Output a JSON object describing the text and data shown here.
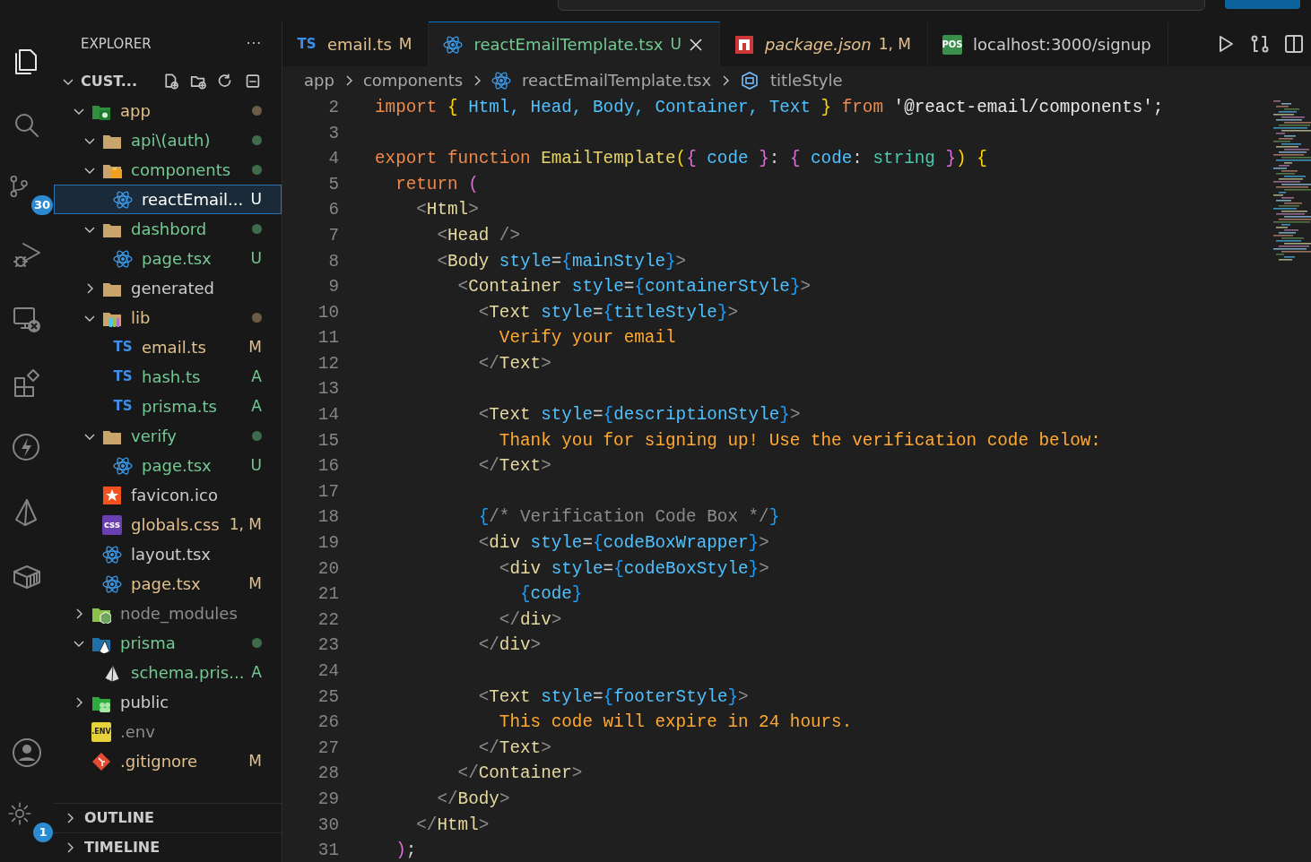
{
  "activity_bar": [
    {
      "kind": "files",
      "selected": true
    },
    {
      "kind": "search",
      "selected": false
    },
    {
      "kind": "branch",
      "selected": false,
      "badge": "30"
    },
    {
      "kind": "debug",
      "selected": false
    },
    {
      "kind": "remote",
      "selected": false
    },
    {
      "kind": "extensions",
      "selected": false
    },
    {
      "kind": "bolt",
      "selected": false
    },
    {
      "kind": "prism",
      "selected": false
    },
    {
      "kind": "box",
      "selected": false
    }
  ],
  "activity_bottom": [
    {
      "kind": "account",
      "selected": false
    },
    {
      "kind": "gear",
      "selected": false,
      "badge": "1"
    }
  ],
  "sidebar": {
    "title": "EXPLORER",
    "more": "···",
    "root": {
      "label": "CUST...",
      "expanded": true
    },
    "tree": [
      {
        "label": "app",
        "kind": "folder-app",
        "color": "#e2c08d",
        "expanded": true,
        "dot": {
          "color": "#6e5b45"
        },
        "selected": false,
        "children": [
          {
            "label": "api\\(auth)",
            "kind": "folder",
            "color": "#73c991",
            "expanded": true,
            "dot": {
              "color": "#3d6b4b"
            },
            "selected": false
          },
          {
            "label": "components",
            "kind": "folder-components",
            "color": "#73c991",
            "expanded": true,
            "dot": {
              "color": "#3d6b4b"
            },
            "selected": false,
            "children": [
              {
                "label": "reactEmail...",
                "kind": "atom",
                "status": "U",
                "selected": true
              }
            ]
          },
          {
            "label": "dashbord",
            "kind": "folder",
            "color": "#73c991",
            "expanded": true,
            "dot": {
              "color": "#3d6b4b"
            },
            "selected": false,
            "children": [
              {
                "label": "page.tsx",
                "kind": "atom",
                "color": "#73c991",
                "status": "U",
                "selected": false
              }
            ]
          },
          {
            "label": "generated",
            "kind": "folder",
            "color": "#cccccc",
            "expanded": false,
            "selected": false
          },
          {
            "label": "lib",
            "kind": "folder-lib",
            "color": "#e2c08d",
            "expanded": true,
            "dot": {
              "color": "#6e5b45"
            },
            "selected": false,
            "children": [
              {
                "label": "email.ts",
                "kind": "ts",
                "icon_label": "TS",
                "color": "#e2c08d",
                "status": "M",
                "selected": false
              },
              {
                "label": "hash.ts",
                "kind": "ts",
                "icon_label": "TS",
                "color": "#73c991",
                "status": "A",
                "selected": false
              },
              {
                "label": "prisma.ts",
                "kind": "ts",
                "icon_label": "TS",
                "color": "#73c991",
                "status": "A",
                "selected": false
              }
            ]
          },
          {
            "label": "verify",
            "kind": "folder",
            "color": "#73c991",
            "expanded": true,
            "dot": {
              "color": "#3d6b4b"
            },
            "selected": false,
            "children": [
              {
                "label": "page.tsx",
                "kind": "atom",
                "color": "#73c991",
                "status": "U",
                "selected": false
              }
            ]
          },
          {
            "label": "favicon.ico",
            "kind": "star",
            "color": "#cccccc",
            "selected": false
          },
          {
            "label": "globals.css",
            "kind": "css",
            "icon_label": "css",
            "color": "#e2c08d",
            "status": "1, M",
            "selected": false
          },
          {
            "label": "layout.tsx",
            "kind": "atom",
            "color": "#cccccc",
            "selected": false
          },
          {
            "label": "page.tsx",
            "kind": "atom",
            "color": "#e2c08d",
            "status": "M",
            "selected": false
          }
        ]
      },
      {
        "label": "node_modules",
        "kind": "folder-node",
        "color": "#8c8c8c",
        "expanded": false,
        "selected": false
      },
      {
        "label": "prisma",
        "kind": "folder-prisma",
        "color": "#73c991",
        "expanded": true,
        "dot": {
          "color": "#3d6b4b"
        },
        "selected": false,
        "children": [
          {
            "label": "schema.pris...",
            "kind": "prism",
            "color": "#73c991",
            "status": "A",
            "selected": false
          }
        ]
      },
      {
        "label": "public",
        "kind": "folder-public",
        "color": "#cccccc",
        "expanded": false,
        "selected": false
      },
      {
        "label": ".env",
        "kind": "env",
        "icon_label": ".ENV",
        "color": "#8c8c8c",
        "selected": false
      },
      {
        "label": ".gitignore",
        "kind": "git",
        "color": "#e2c08d",
        "status": "M",
        "selected": false
      }
    ],
    "sections": [
      {
        "label": "OUTLINE",
        "expanded": false
      },
      {
        "label": "TIMELINE",
        "expanded": false
      }
    ]
  },
  "tabs": [
    {
      "label": "email.ts",
      "kind": "ts",
      "icon_label": "TS",
      "status": "M",
      "color": "#e2c08d",
      "selected": false,
      "preview": false
    },
    {
      "label": "reactEmailTemplate.tsx",
      "kind": "atom",
      "status": "U",
      "color": "#73c991",
      "selected": true,
      "preview": false
    },
    {
      "label": "package.json",
      "kind": "npm",
      "status": "1, M",
      "color": "#e2c08d",
      "selected": false,
      "preview": true
    },
    {
      "label": "localhost:3000/signup",
      "kind": "pos",
      "icon_label": "POS",
      "color": "#cccccc",
      "selected": false,
      "preview": false
    }
  ],
  "breadcrumb": [
    {
      "label": "app"
    },
    {
      "label": "components"
    },
    {
      "label": "reactEmailTemplate.tsx",
      "kind": "atom"
    },
    {
      "label": "titleStyle",
      "kind": "symbol"
    }
  ],
  "code": [
    {
      "number": "2",
      "tokens": [
        {
          "kind": "kw",
          "text": "import "
        },
        {
          "kind": "b1",
          "text": "{"
        },
        {
          "kind": "id",
          "text": " Html, Head, Body, Container, Text "
        },
        {
          "kind": "b1",
          "text": "}"
        },
        {
          "kind": "kw",
          "text": " from "
        },
        {
          "kind": "str",
          "text": "'@react-email/components';"
        }
      ]
    },
    {
      "number": "3"
    },
    {
      "number": "4",
      "tokens": [
        {
          "kind": "kw",
          "text": "export function "
        },
        {
          "kind": "fn",
          "text": "EmailTemplate"
        },
        {
          "kind": "b1",
          "text": "("
        },
        {
          "kind": "b2",
          "text": "{"
        },
        {
          "kind": "id",
          "text": " code "
        },
        {
          "kind": "b2",
          "text": "}"
        },
        {
          "kind": "p",
          "text": ": "
        },
        {
          "kind": "b2",
          "text": "{"
        },
        {
          "kind": "id",
          "text": " code"
        },
        {
          "kind": "p",
          "text": ": "
        },
        {
          "kind": "type",
          "text": "string"
        },
        {
          "kind": "b2",
          "text": " }"
        },
        {
          "kind": "b1",
          "text": ") {"
        }
      ]
    },
    {
      "number": "5",
      "tokens": [
        {
          "kind": "kw",
          "text": "  return "
        },
        {
          "kind": "b2",
          "text": "("
        }
      ]
    },
    {
      "number": "6",
      "tokens": [
        {
          "kind": "tb",
          "text": "    <"
        },
        {
          "kind": "tag",
          "text": "Html"
        },
        {
          "kind": "tb",
          "text": ">"
        }
      ]
    },
    {
      "number": "7",
      "tokens": [
        {
          "kind": "tb",
          "text": "      <"
        },
        {
          "kind": "tag",
          "text": "Head"
        },
        {
          "kind": "tb",
          "text": " />"
        }
      ]
    },
    {
      "number": "8",
      "tokens": [
        {
          "kind": "tb",
          "text": "      <"
        },
        {
          "kind": "tag",
          "text": "Body"
        },
        {
          "kind": "attr",
          "text": " style"
        },
        {
          "kind": "p",
          "text": "="
        },
        {
          "kind": "b3",
          "text": "{"
        },
        {
          "kind": "id",
          "text": "mainStyle"
        },
        {
          "kind": "b3",
          "text": "}"
        },
        {
          "kind": "tb",
          "text": ">"
        }
      ]
    },
    {
      "number": "9",
      "tokens": [
        {
          "kind": "tb",
          "text": "        <"
        },
        {
          "kind": "tag",
          "text": "Container"
        },
        {
          "kind": "attr",
          "text": " style"
        },
        {
          "kind": "p",
          "text": "="
        },
        {
          "kind": "b3",
          "text": "{"
        },
        {
          "kind": "id",
          "text": "containerStyle"
        },
        {
          "kind": "b3",
          "text": "}"
        },
        {
          "kind": "tb",
          "text": ">"
        }
      ]
    },
    {
      "number": "10",
      "tokens": [
        {
          "kind": "tb",
          "text": "          <"
        },
        {
          "kind": "tag",
          "text": "Text"
        },
        {
          "kind": "attr",
          "text": " style"
        },
        {
          "kind": "p",
          "text": "="
        },
        {
          "kind": "b3",
          "text": "{"
        },
        {
          "kind": "id",
          "text": "titleStyle"
        },
        {
          "kind": "b3",
          "text": "}"
        },
        {
          "kind": "tb",
          "text": ">"
        }
      ]
    },
    {
      "number": "11",
      "tokens": [
        {
          "kind": "txt",
          "text": "            Verify your email"
        }
      ]
    },
    {
      "number": "12",
      "tokens": [
        {
          "kind": "tb",
          "text": "          </"
        },
        {
          "kind": "tag",
          "text": "Text"
        },
        {
          "kind": "tb",
          "text": ">"
        }
      ]
    },
    {
      "number": "13"
    },
    {
      "number": "14",
      "tokens": [
        {
          "kind": "tb",
          "text": "          <"
        },
        {
          "kind": "tag",
          "text": "Text"
        },
        {
          "kind": "attr",
          "text": " style"
        },
        {
          "kind": "p",
          "text": "="
        },
        {
          "kind": "b3",
          "text": "{"
        },
        {
          "kind": "id",
          "text": "descriptionStyle"
        },
        {
          "kind": "b3",
          "text": "}"
        },
        {
          "kind": "tb",
          "text": ">"
        }
      ]
    },
    {
      "number": "15",
      "tokens": [
        {
          "kind": "txt",
          "text": "            Thank you for signing up! Use the verification code below:"
        }
      ]
    },
    {
      "number": "16",
      "tokens": [
        {
          "kind": "tb",
          "text": "          </"
        },
        {
          "kind": "tag",
          "text": "Text"
        },
        {
          "kind": "tb",
          "text": ">"
        }
      ]
    },
    {
      "number": "17"
    },
    {
      "number": "18",
      "tokens": [
        {
          "kind": "b3",
          "text": "          {"
        },
        {
          "kind": "cm",
          "text": "/* Verification Code Box */"
        },
        {
          "kind": "b3",
          "text": "}"
        }
      ]
    },
    {
      "number": "19",
      "tokens": [
        {
          "kind": "tb",
          "text": "          <"
        },
        {
          "kind": "tag",
          "text": "div"
        },
        {
          "kind": "attr",
          "text": " style"
        },
        {
          "kind": "p",
          "text": "="
        },
        {
          "kind": "b3",
          "text": "{"
        },
        {
          "kind": "id",
          "text": "codeBoxWrapper"
        },
        {
          "kind": "b3",
          "text": "}"
        },
        {
          "kind": "tb",
          "text": ">"
        }
      ]
    },
    {
      "number": "20",
      "tokens": [
        {
          "kind": "tb",
          "text": "            <"
        },
        {
          "kind": "tag",
          "text": "div"
        },
        {
          "kind": "attr",
          "text": " style"
        },
        {
          "kind": "p",
          "text": "="
        },
        {
          "kind": "b3",
          "text": "{"
        },
        {
          "kind": "id",
          "text": "codeBoxStyle"
        },
        {
          "kind": "b3",
          "text": "}"
        },
        {
          "kind": "tb",
          "text": ">"
        }
      ]
    },
    {
      "number": "21",
      "tokens": [
        {
          "kind": "b3",
          "text": "              {"
        },
        {
          "kind": "id",
          "text": "code"
        },
        {
          "kind": "b3",
          "text": "}"
        }
      ]
    },
    {
      "number": "22",
      "tokens": [
        {
          "kind": "tb",
          "text": "            </"
        },
        {
          "kind": "tag",
          "text": "div"
        },
        {
          "kind": "tb",
          "text": ">"
        }
      ]
    },
    {
      "number": "23",
      "tokens": [
        {
          "kind": "tb",
          "text": "          </"
        },
        {
          "kind": "tag",
          "text": "div"
        },
        {
          "kind": "tb",
          "text": ">"
        }
      ]
    },
    {
      "number": "24"
    },
    {
      "number": "25",
      "tokens": [
        {
          "kind": "tb",
          "text": "          <"
        },
        {
          "kind": "tag",
          "text": "Text"
        },
        {
          "kind": "attr",
          "text": " style"
        },
        {
          "kind": "p",
          "text": "="
        },
        {
          "kind": "b3",
          "text": "{"
        },
        {
          "kind": "id",
          "text": "footerStyle"
        },
        {
          "kind": "b3",
          "text": "}"
        },
        {
          "kind": "tb",
          "text": ">"
        }
      ]
    },
    {
      "number": "26",
      "tokens": [
        {
          "kind": "txt",
          "text": "            This code will expire in 24 hours."
        }
      ]
    },
    {
      "number": "27",
      "tokens": [
        {
          "kind": "tb",
          "text": "          </"
        },
        {
          "kind": "tag",
          "text": "Text"
        },
        {
          "kind": "tb",
          "text": ">"
        }
      ]
    },
    {
      "number": "28",
      "tokens": [
        {
          "kind": "tb",
          "text": "        </"
        },
        {
          "kind": "tag",
          "text": "Container"
        },
        {
          "kind": "tb",
          "text": ">"
        }
      ]
    },
    {
      "number": "29",
      "tokens": [
        {
          "kind": "tb",
          "text": "      </"
        },
        {
          "kind": "tag",
          "text": "Body"
        },
        {
          "kind": "tb",
          "text": ">"
        }
      ]
    },
    {
      "number": "30",
      "tokens": [
        {
          "kind": "tb",
          "text": "    </"
        },
        {
          "kind": "tag",
          "text": "Html"
        },
        {
          "kind": "tb",
          "text": ">"
        }
      ]
    },
    {
      "number": "31",
      "tokens": [
        {
          "kind": "b2",
          "text": "  )"
        },
        {
          "kind": "p",
          "text": ";"
        }
      ]
    }
  ]
}
